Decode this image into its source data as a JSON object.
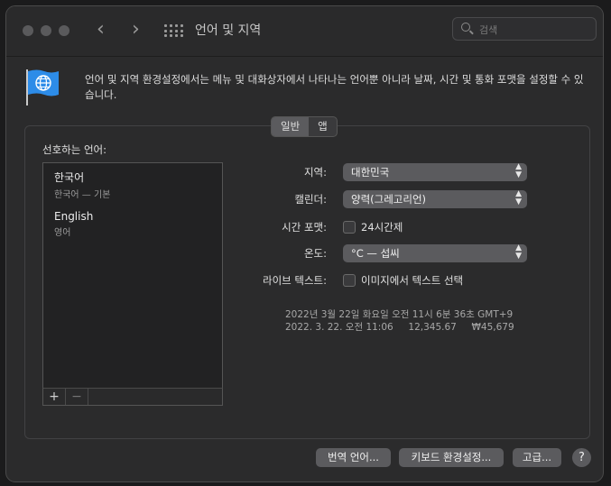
{
  "window": {
    "title": "언어 및 지역",
    "search_placeholder": "검색",
    "description": "언어 및 지역 환경설정에서는 메뉴 및 대화상자에서 나타나는 언어뿐 아니라 날짜, 시간 및 통화 포맷을 설정할 수 있습니다."
  },
  "tabs": [
    {
      "label": "일반",
      "active": true
    },
    {
      "label": "앱",
      "active": false
    }
  ],
  "preferred_languages": {
    "label": "선호하는 언어:",
    "items": [
      {
        "name": "한국어",
        "sub": "한국어 — 기본"
      },
      {
        "name": "English",
        "sub": "영어"
      }
    ],
    "add": "+",
    "remove": "−"
  },
  "settings": {
    "region_label": "지역:",
    "region_value": "대한민국",
    "calendar_label": "캘린더:",
    "calendar_value": "양력(그레고리언)",
    "time_format_label": "시간 포맷:",
    "time_format_checkbox": "24시간제",
    "temperature_label": "온도:",
    "temperature_value": "°C — 섭씨",
    "live_text_label": "라이브 텍스트:",
    "live_text_checkbox": "이미지에서 텍스트 선택"
  },
  "sample": {
    "line1": "2022년 3월 22일 화요일 오전 11시 6분 36초 GMT+9",
    "line2": "2022. 3. 22. 오전 11:06     12,345.67     ₩45,679"
  },
  "buttons": {
    "translation": "번역 언어...",
    "keyboard": "키보드 환경설정...",
    "advanced": "고급...",
    "help": "?"
  },
  "colors": {
    "window_bg": "#2b2b2c",
    "control_bg": "#5b5b5e",
    "flag_blue": "#2d8ce8"
  }
}
